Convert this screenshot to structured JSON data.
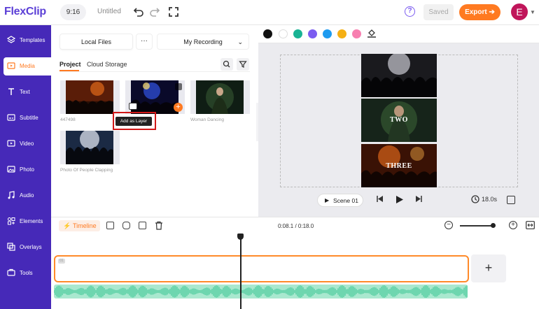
{
  "app": {
    "logo": "FlexClip",
    "ratio": "9:16",
    "project_title": "Untitled",
    "saved_label": "Saved",
    "export_label": "Export",
    "avatar_letter": "E",
    "accent": "#ff7a21",
    "sidebar_color": "#4629b8"
  },
  "sidebar": {
    "items": [
      {
        "label": "Templates",
        "icon": "layers-icon"
      },
      {
        "label": "Media",
        "icon": "media-icon",
        "active": true
      },
      {
        "label": "Text",
        "icon": "text-icon"
      },
      {
        "label": "Subtitle",
        "icon": "subtitle-icon"
      },
      {
        "label": "Video",
        "icon": "video-icon"
      },
      {
        "label": "Photo",
        "icon": "photo-icon"
      },
      {
        "label": "Audio",
        "icon": "audio-icon"
      },
      {
        "label": "Elements",
        "icon": "elements-icon"
      },
      {
        "label": "Overlays",
        "icon": "overlays-icon"
      },
      {
        "label": "Tools",
        "icon": "tools-icon"
      }
    ]
  },
  "media": {
    "local_files_label": "Local Files",
    "more_label": "···",
    "recording_label": "My Recording",
    "tabs": [
      "Project",
      "Cloud Storage"
    ],
    "items": [
      {
        "caption": "447498"
      },
      {
        "caption": ""
      },
      {
        "caption": "Woman Dancing"
      },
      {
        "caption": "Photo Of People Clapping"
      }
    ],
    "tooltip": "Add as Layer"
  },
  "preview": {
    "colors": [
      "#111111",
      "#ffffff",
      "#19b394",
      "#7b5cf0",
      "#1e9bf0",
      "#f5b014",
      "#f77fb0"
    ],
    "frames": [
      {
        "text": ""
      },
      {
        "text": "TWO"
      },
      {
        "text": "THREE"
      }
    ],
    "scene_label": "Scene 01",
    "duration": "18.0s"
  },
  "timeline": {
    "label": "Timeline",
    "time": "0:08.1 / 0:18.0",
    "zoom_level": 0.88
  }
}
